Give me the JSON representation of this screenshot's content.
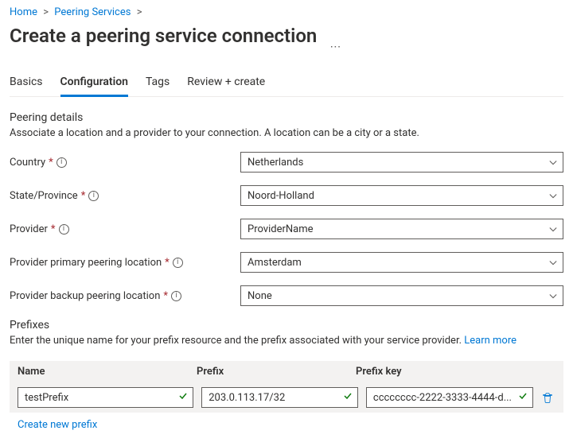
{
  "breadcrumb": {
    "home": "Home",
    "peering_services": "Peering Services"
  },
  "title": "Create a peering service connection",
  "tabs": {
    "basics": "Basics",
    "configuration": "Configuration",
    "tags": "Tags",
    "review": "Review + create"
  },
  "peering_details": {
    "title": "Peering details",
    "desc": "Associate a location and a provider to your connection. A location can be a city or a state."
  },
  "fields": {
    "country": {
      "label": "Country",
      "value": "Netherlands"
    },
    "state": {
      "label": "State/Province",
      "value": "Noord-Holland"
    },
    "provider": {
      "label": "Provider",
      "value": "ProviderName"
    },
    "primary_loc": {
      "label": "Provider primary peering location",
      "value": "Amsterdam"
    },
    "backup_loc": {
      "label": "Provider backup peering location",
      "value": "None"
    }
  },
  "prefixes": {
    "title": "Prefixes",
    "desc": "Enter the unique name for your prefix resource and the prefix associated with your service provider.",
    "learn_more": "Learn more",
    "headers": {
      "name": "Name",
      "prefix": "Prefix",
      "key": "Prefix key"
    },
    "row": {
      "name": "testPrefix",
      "prefix": "203.0.113.17/32",
      "key": "cccccccc-2222-3333-4444-d..."
    },
    "create_link": "Create new prefix"
  }
}
